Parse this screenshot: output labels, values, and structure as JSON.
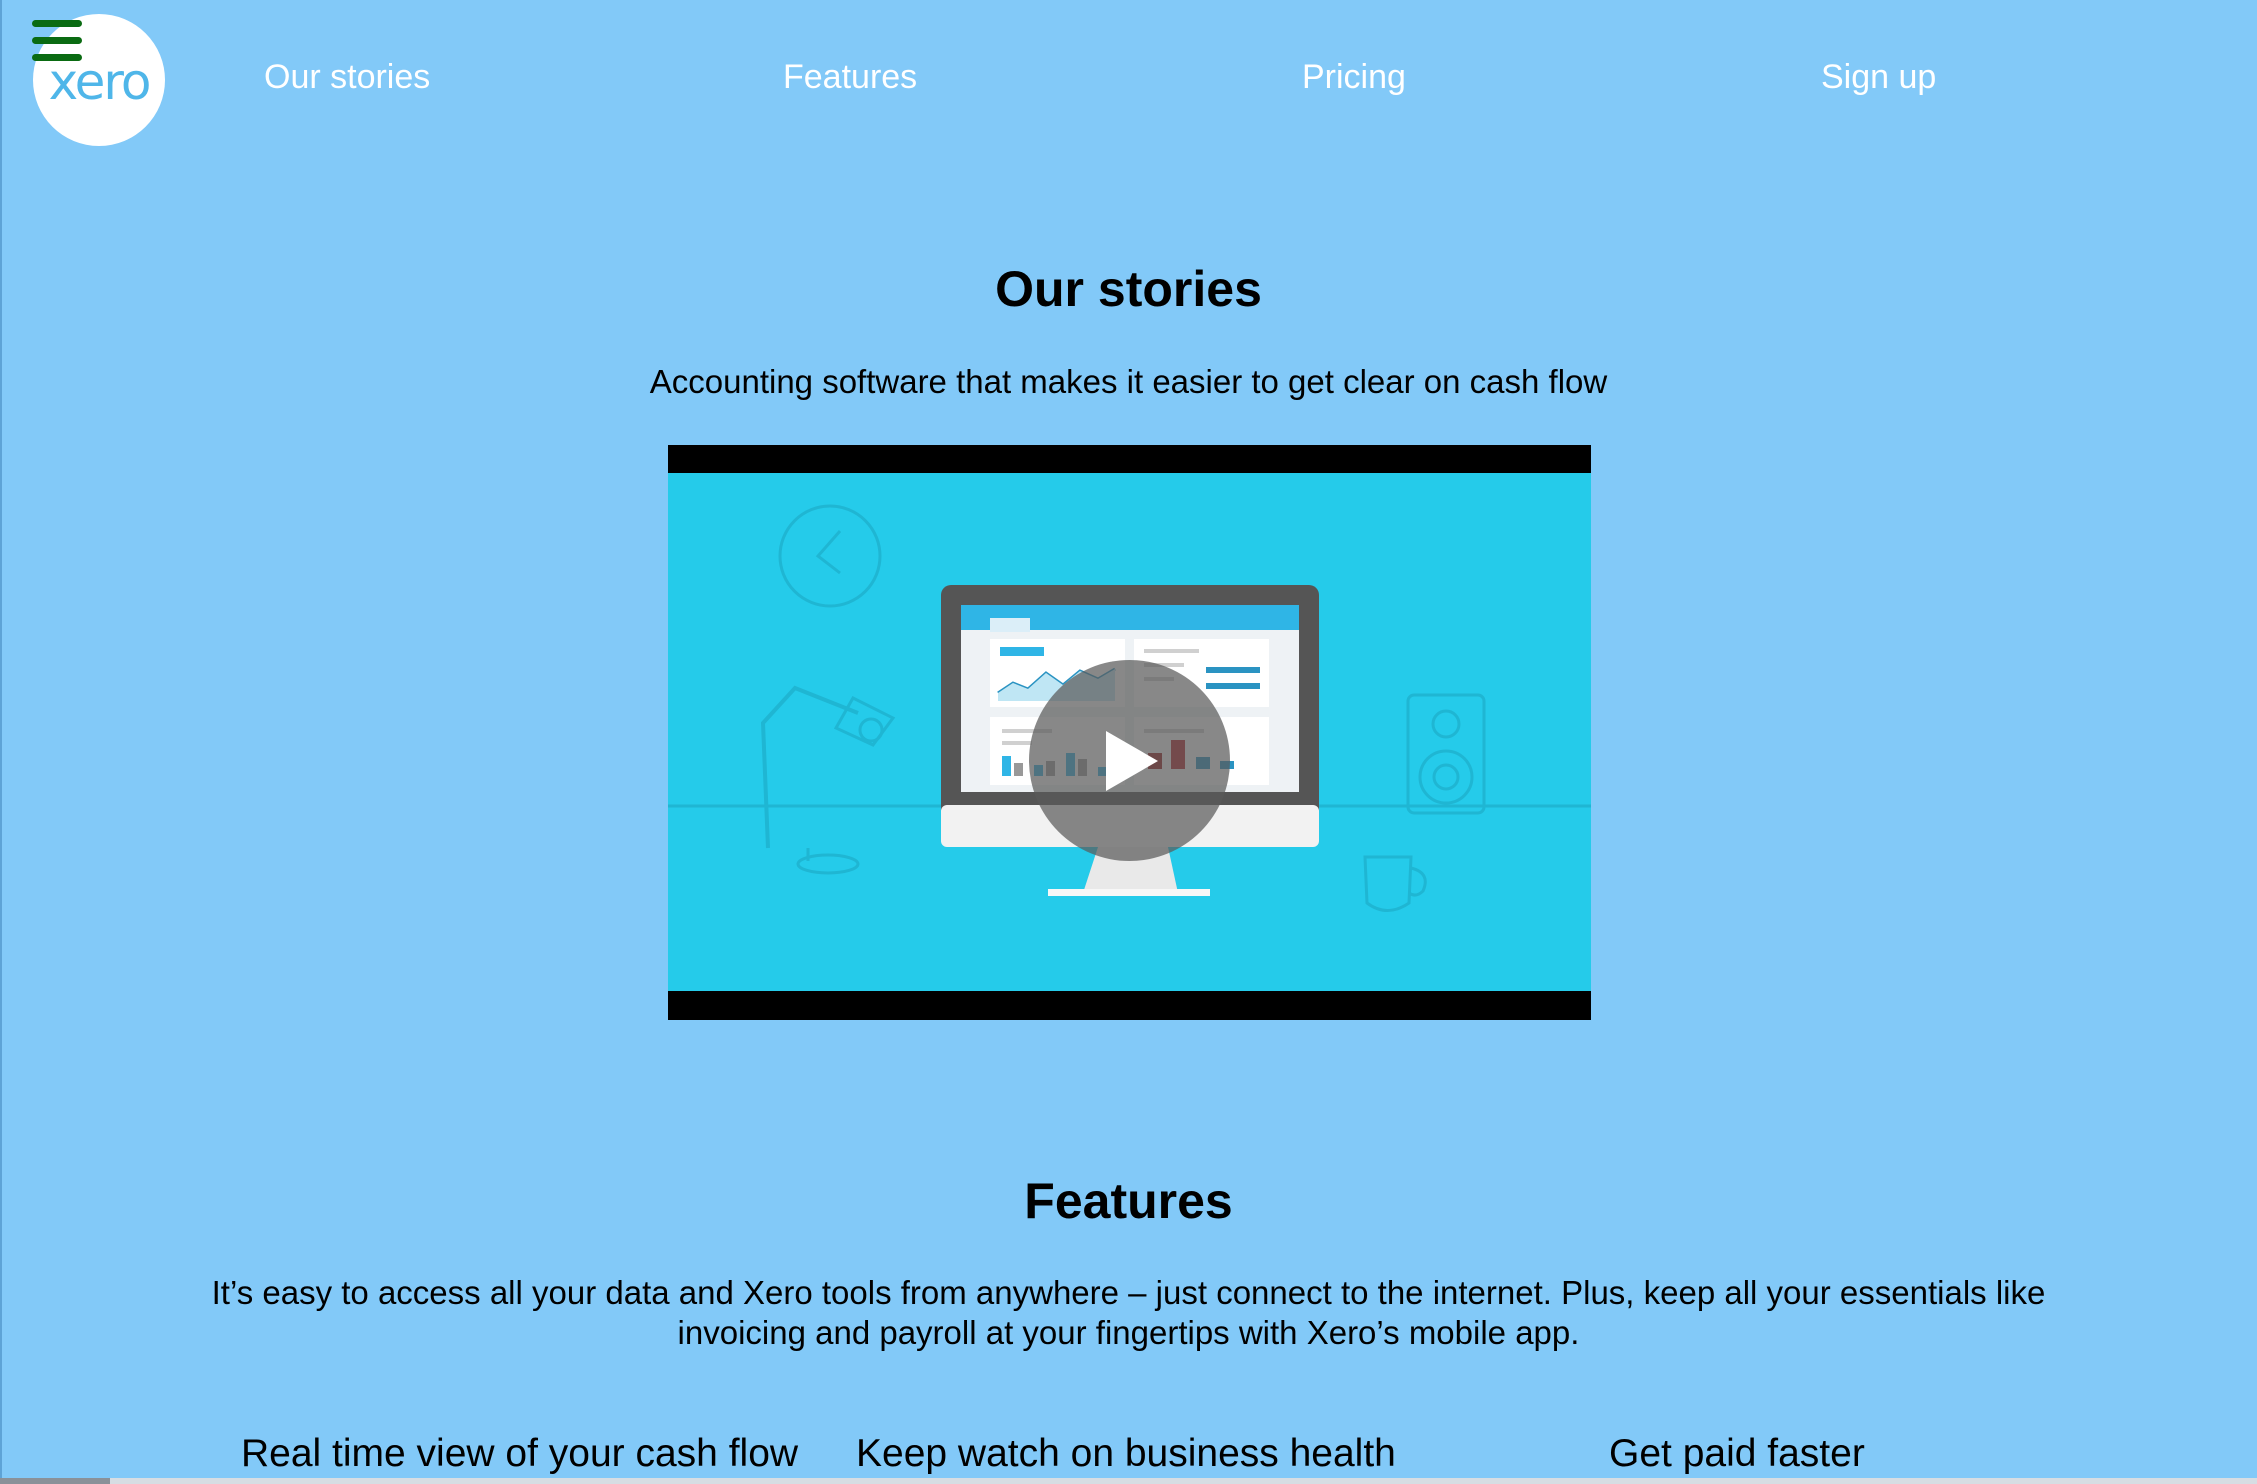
{
  "header": {
    "logo_text": "xero",
    "nav": [
      {
        "label": "Our stories"
      },
      {
        "label": "Features"
      },
      {
        "label": "Pricing"
      },
      {
        "label": "Sign up"
      }
    ]
  },
  "stories": {
    "title": "Our stories",
    "subtitle": "Accounting software that makes it easier to get clear on cash flow"
  },
  "features": {
    "title": "Features",
    "description_line1": "It’s easy to access all your data and Xero tools from anywhere – just connect to the internet. Plus, keep all your essentials like",
    "description_line2": "invoicing and payroll at your fingertips with Xero’s mobile app.",
    "columns": [
      {
        "title": "Real time view of your cash flow"
      },
      {
        "title": "Keep watch on business health"
      },
      {
        "title": "Get paid faster"
      }
    ]
  },
  "icons": {
    "menu": "hamburger-menu-icon",
    "play": "play-icon"
  },
  "colors": {
    "background": "#82c9f8",
    "nav_text": "#ffffff",
    "menu_icon": "#0a6b12",
    "logo": "#4fb6e9",
    "video_bg": "#25cbea"
  }
}
